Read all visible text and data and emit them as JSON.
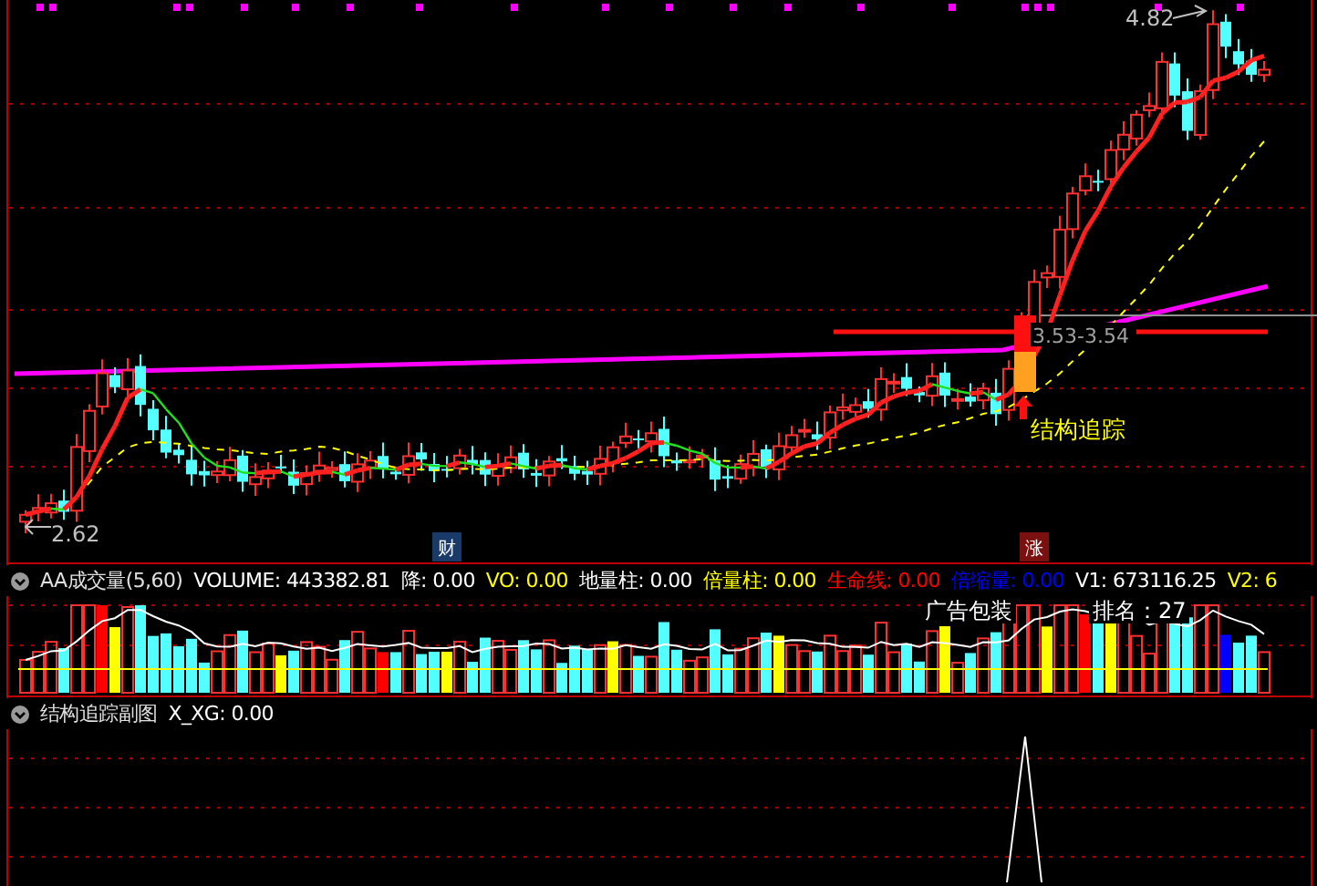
{
  "main_chart": {
    "high_label": "4.82",
    "low_label": "2.62",
    "range_label": "3.53-3.54",
    "signal_label": "结构追踪"
  },
  "markers": [
    {
      "text": "财",
      "color": "#1a3a6a"
    },
    {
      "text": "涨",
      "color": "#7a1010"
    }
  ],
  "volume_panel": {
    "indicator_name": "AA成交量(5,60)",
    "readouts": [
      {
        "text": "VOLUME: 443382.81",
        "color": "#ffffff"
      },
      {
        "text": "降: 0.00",
        "color": "#ffffff"
      },
      {
        "text": "VO: 0.00",
        "color": "#ffff00"
      },
      {
        "text": "地量柱: 0.00",
        "color": "#ffffff"
      },
      {
        "text": "倍量柱: 0.00",
        "color": "#ffff00"
      },
      {
        "text": "生命线: 0.00",
        "color": "#ff0000"
      },
      {
        "text": "倍缩量: 0.00",
        "color": "#0000ff"
      },
      {
        "text": "V1: 673116.25",
        "color": "#ffffff"
      },
      {
        "text": "V2: 6",
        "color": "#ffff00"
      }
    ],
    "annotations": [
      "广告包装",
      "排名：27"
    ]
  },
  "sub_panel": {
    "indicator_name": "结构追踪副图",
    "readouts": [
      {
        "text": "X_XG: 0.00",
        "color": "#ffffff"
      }
    ]
  }
}
